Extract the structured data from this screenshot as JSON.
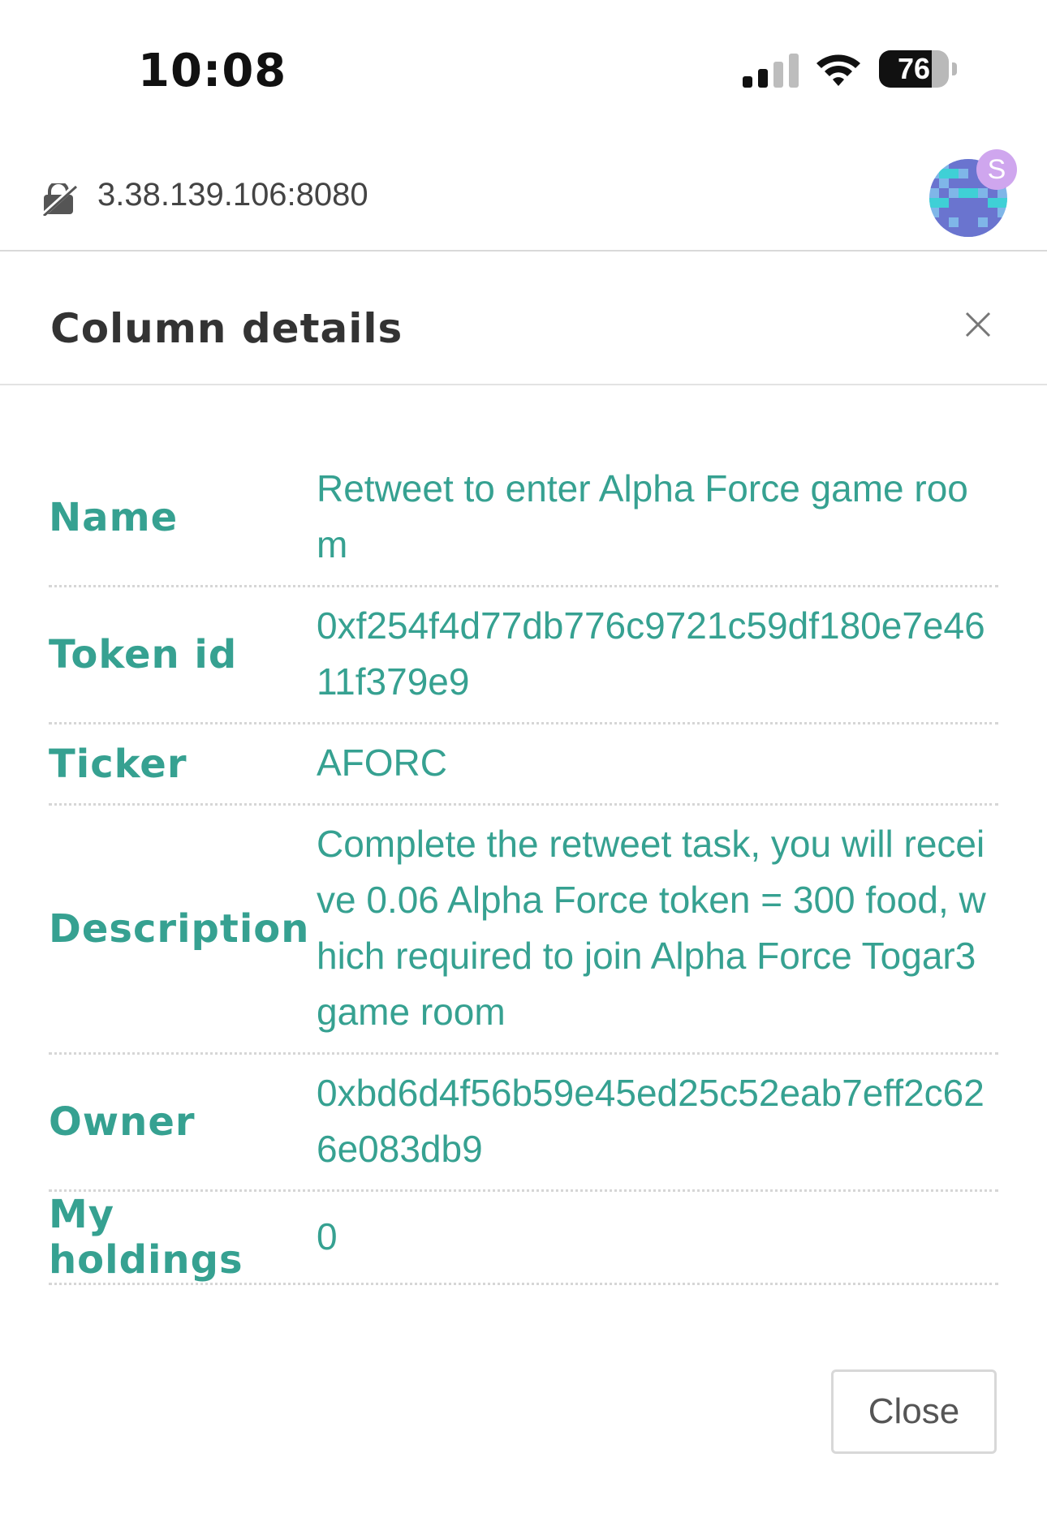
{
  "status_bar": {
    "time": "10:08",
    "battery_percent": "76",
    "battery_level": 0.76
  },
  "browser": {
    "url": "3.38.139.106:8080",
    "avatar_badge": "S"
  },
  "modal": {
    "title": "Column details",
    "rows": [
      {
        "label": "Name",
        "value": "Retweet to enter Alpha Force game room"
      },
      {
        "label": "Token id",
        "value": "0xf254f4d77db776c9721c59df180e7e4611f379e9"
      },
      {
        "label": "Ticker",
        "value": "AFORC"
      },
      {
        "label": "Description",
        "value": "Complete the retweet task, you will receive 0.06 Alpha Force token = 300 food, which required to join Alpha Force Togar3 game room"
      },
      {
        "label": "Owner",
        "value": "0xbd6d4f56b59e45ed25c52eab7eff2c626e083db9"
      },
      {
        "label": "My holdings",
        "value": "0"
      }
    ],
    "close_label": "Close"
  },
  "colors": {
    "accent": "#36a191",
    "title": "#333333",
    "divider": "#d6d6d6"
  }
}
